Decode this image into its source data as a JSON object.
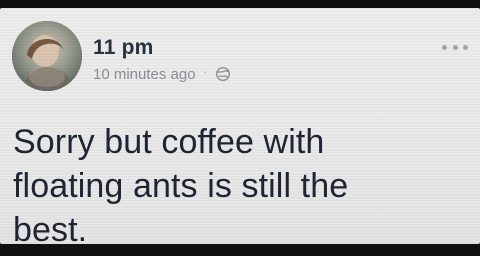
{
  "post": {
    "author": "11 pm",
    "timestamp": "10 minutes ago",
    "separator": "·",
    "privacy_icon": "globe-icon",
    "text": "Sorry but coffee with\nfloating ants is still the\nbest."
  },
  "actions": {
    "more_icon": "more-options-icon"
  },
  "colors": {
    "card_bg": "#ececec",
    "author_text": "#2a3140",
    "meta_text": "#8c8f95",
    "body_text": "#1f2533",
    "frame_border": "#111111"
  }
}
